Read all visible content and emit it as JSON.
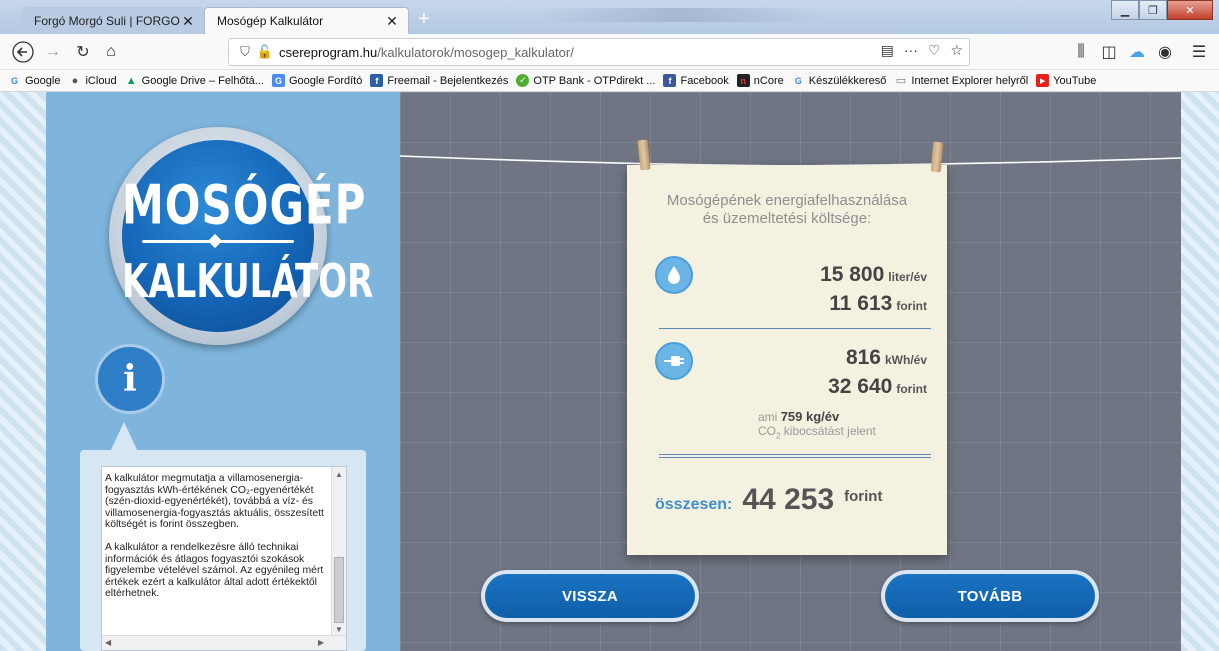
{
  "browser": {
    "tabs": [
      {
        "label": "Forgó Morgó Suli | FORGOMO"
      },
      {
        "label": "Mosógép Kalkulátor"
      }
    ],
    "url_domain": "csereprogram.hu",
    "url_path": "/kalkulatorok/mosogep_kalkulator/",
    "bookmarks": [
      {
        "label": "Google",
        "icon": "google-icon",
        "color": "#4285f4"
      },
      {
        "label": "iCloud",
        "icon": "apple-icon",
        "color": "#555555"
      },
      {
        "label": "Google Drive – Felhőtá...",
        "icon": "drive-icon",
        "color": "#0f9d58"
      },
      {
        "label": "Google Fordító",
        "icon": "translate-icon",
        "color": "#4a8af4"
      },
      {
        "label": "Freemail - Bejelentkezés",
        "icon": "freemail-icon",
        "color": "#2b5fa8"
      },
      {
        "label": "OTP Bank - OTPdirekt ...",
        "icon": "otp-icon",
        "color": "#52ae32"
      },
      {
        "label": "Facebook",
        "icon": "facebook-icon",
        "color": "#3b5998"
      },
      {
        "label": "nCore",
        "icon": "ncore-icon",
        "color": "#222222"
      },
      {
        "label": "Készülékkereső",
        "icon": "google-icon",
        "color": "#4285f4"
      },
      {
        "label": "Internet Explorer helyről",
        "icon": "folder-icon",
        "color": "#777777"
      },
      {
        "label": "YouTube",
        "icon": "youtube-icon",
        "color": "#e62117"
      }
    ]
  },
  "logo": {
    "line1": "MOSÓGÉP",
    "line2": "KALKULÁTOR"
  },
  "info": {
    "icon_letter": "i",
    "para1": "A kalkulátor megmutatja a villamosenergia-fogyasztás kWh-értékének CO₂-egyenértékét (szén-dioxid-egyenértékét), továbbá a víz- és villamosenergia-fogyasztás aktuális, összesített költségét is forint összegben.",
    "para2": "A kalkulátor a rendelkezésre álló technikai információk és átlagos fogyasztói szokások figyelembe vételével számol. Az egyénileg mért értékek ezért a kalkulátor által adott értékektől eltérhetnek."
  },
  "card": {
    "heading1": "Mosógépének energiafelhasználása",
    "heading2": "és üzemeltetési költsége:",
    "water": {
      "amount": "15 800",
      "amount_unit": "liter/év",
      "cost": "11 613",
      "cost_unit": "forint"
    },
    "electricity": {
      "amount": "816",
      "amount_unit": "kWh/év",
      "cost": "32 640",
      "cost_unit": "forint"
    },
    "co2": {
      "prefix": "ami",
      "value": "759 kg/év",
      "line2_a": "CO",
      "line2_sub": "2",
      "line2_b": " kibocsátást jelent"
    },
    "total": {
      "label": "összesen:",
      "value": "44 253",
      "unit": "forint"
    }
  },
  "buttons": {
    "back": "VISSZA",
    "next": "TOVÁBB"
  },
  "colors": {
    "accent_blue": "#0f5ea8",
    "panel_blue": "#7fb5dd",
    "paper": "#f5f1e1"
  }
}
